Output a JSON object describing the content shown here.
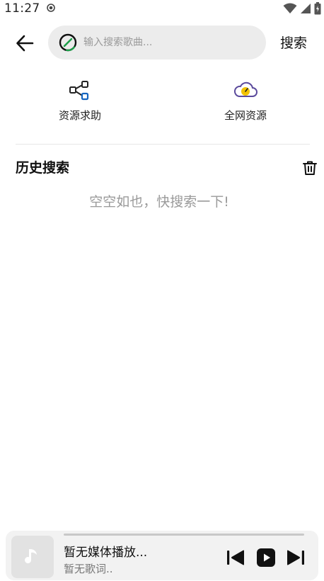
{
  "status_bar": {
    "time": "11:27"
  },
  "search": {
    "placeholder": "输入搜索歌曲...",
    "button_label": "搜索"
  },
  "quick_actions": {
    "resource_help": "资源求助",
    "all_network": "全网资源"
  },
  "history": {
    "title": "历史搜索",
    "empty_message": "空空如也，快搜索一下!"
  },
  "player": {
    "title": "暂无媒体播放...",
    "lyric": "暂无歌词..",
    "progress": 0
  },
  "colors": {
    "accent_green": "#1e9e4a",
    "accent_blue": "#1565c0",
    "cloud_yellow": "#f2c200",
    "cloud_purple": "#5b4a9c"
  }
}
